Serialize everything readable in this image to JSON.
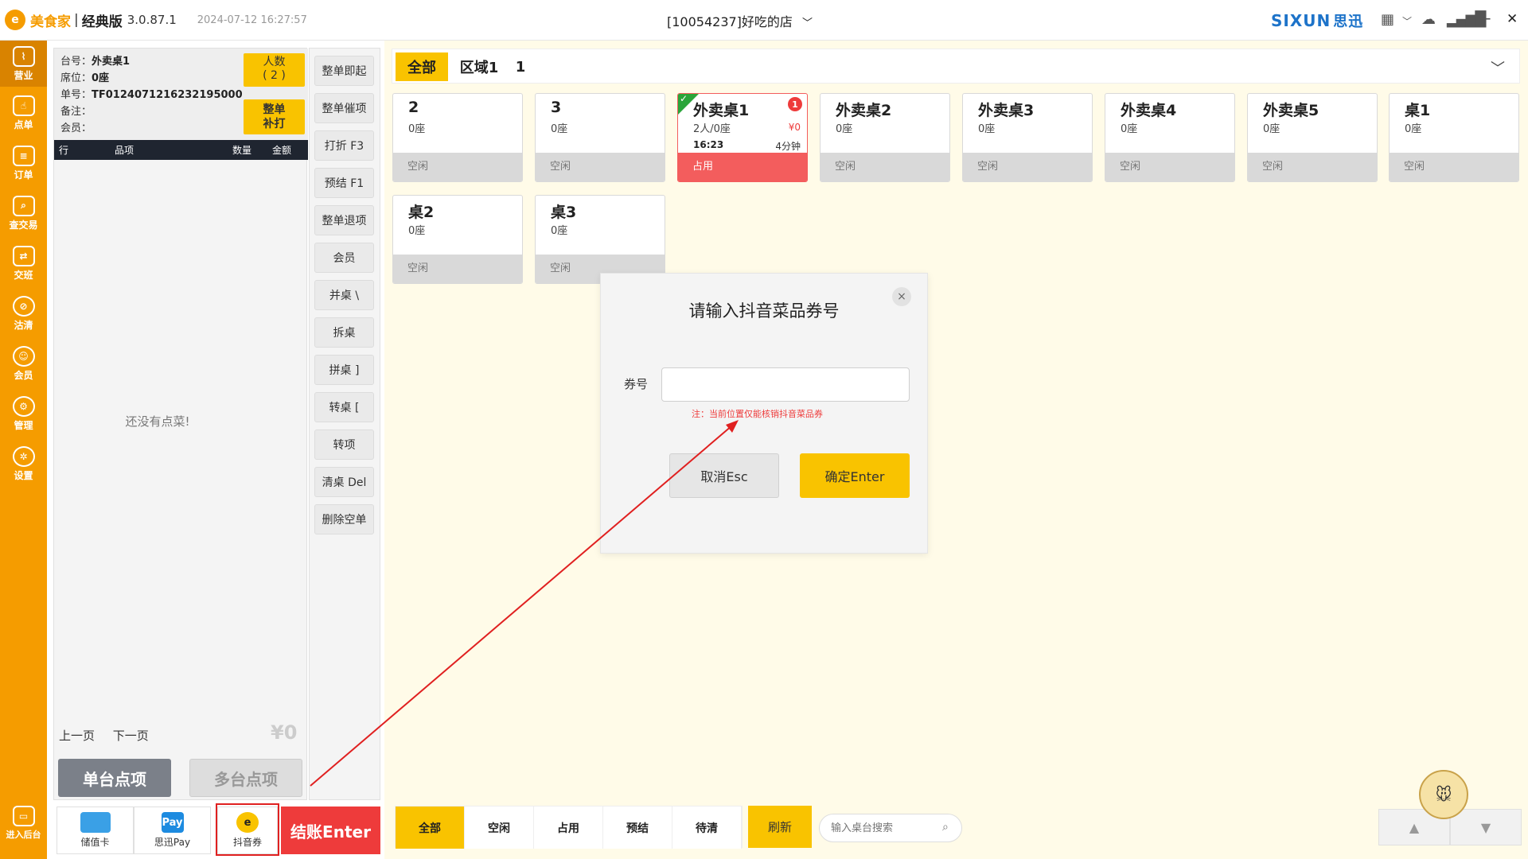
{
  "titlebar": {
    "brand": "美食家",
    "separator": "|",
    "edition": "经典版",
    "version": "3.0.87.1",
    "datetime": "2024-07-12 16:27:57",
    "store": "[10054237]好吃的店",
    "sixun_logo": "SIXUN",
    "sixun_cn": "思迅",
    "icons": [
      "grid-icon",
      "cloud-icon",
      "signal-icon",
      "minimize-icon",
      "close-icon"
    ],
    "minimize": "−",
    "close": "✕"
  },
  "sidebar": {
    "items": [
      {
        "label": "营业",
        "icon": "chart-icon",
        "active": true
      },
      {
        "label": "点单",
        "icon": "hand-icon"
      },
      {
        "label": "订单",
        "icon": "order-icon"
      },
      {
        "label": "查交易",
        "icon": "search-doc-icon"
      },
      {
        "label": "交班",
        "icon": "shift-icon"
      },
      {
        "label": "沽清",
        "icon": "soldout-icon"
      },
      {
        "label": "会员",
        "icon": "member-icon"
      },
      {
        "label": "管理",
        "icon": "manage-icon"
      },
      {
        "label": "设置",
        "icon": "settings-icon"
      }
    ],
    "backend": "进入后台"
  },
  "order": {
    "table_label": "台号：",
    "table_value": "外卖桌1",
    "seat_label": "席位：",
    "seat_value": "0座",
    "bill_label": "单号：",
    "bill_value": "TF0124071216232195000",
    "remark_label": "备注：",
    "member_label": "会员：",
    "people_btn": "人数",
    "people_count": "( 2 )",
    "reprint_btn_1": "整单",
    "reprint_btn_2": "补打",
    "columns": [
      "行",
      "品项",
      "数量",
      "金额"
    ],
    "empty": "还没有点菜!",
    "prev_page": "上一页",
    "next_page": "下一页",
    "total": "¥0",
    "single_order": "单台点项",
    "multi_order": "多台点项"
  },
  "actions": [
    "整单即起",
    "整单催项",
    "打折 F3",
    "预结 F1",
    "整单退项",
    "会员",
    "并桌 \\",
    "拆桌",
    "拼桌 ]",
    "转桌 [",
    "转项",
    "清桌 Del",
    "删除空单"
  ],
  "payments": [
    {
      "label": "储值卡",
      "icon": "card-icon",
      "color": "#3aa0e6"
    },
    {
      "label": "思迅Pay",
      "icon": "pay-icon",
      "glyph": "Pay",
      "color": "#1d8be0"
    },
    {
      "label": "抖音券",
      "icon": "douyin-coupon-icon",
      "color": "#f9c300"
    }
  ],
  "checkout": "结账Enter",
  "areas": {
    "tabs": [
      "全部",
      "区域1",
      "1"
    ]
  },
  "tables": [
    {
      "name": "2",
      "seat": "0座",
      "status": "空闲"
    },
    {
      "name": "3",
      "seat": "0座",
      "status": "空闲"
    },
    {
      "name": "外卖桌1",
      "seat": "2人/0座",
      "status": "占用",
      "amount": "¥0",
      "time": "16:23",
      "duration": "4分钟",
      "badge": "1",
      "occupied": true
    },
    {
      "name": "外卖桌2",
      "seat": "0座",
      "status": "空闲"
    },
    {
      "name": "外卖桌3",
      "seat": "0座",
      "status": "空闲"
    },
    {
      "name": "外卖桌4",
      "seat": "0座",
      "status": "空闲"
    },
    {
      "name": "外卖桌5",
      "seat": "0座",
      "status": "空闲"
    },
    {
      "name": "桌1",
      "seat": "0座",
      "status": "空闲"
    },
    {
      "name": "桌2",
      "seat": "0座",
      "status": "空闲"
    },
    {
      "name": "桌3",
      "seat": "0座",
      "status": "空闲"
    }
  ],
  "modal": {
    "title": "请输入抖音菜品券号",
    "label": "券号",
    "input_value": "",
    "note": "注：当前位置仅能核销抖音菜品券",
    "cancel": "取消Esc",
    "confirm": "确定Enter",
    "close_glyph": "×"
  },
  "filters": [
    "全部",
    "空闲",
    "占用",
    "预结",
    "待清"
  ],
  "refresh": "刷新",
  "search_placeholder": "输入桌台搜索",
  "colors": {
    "brand": "#f59c00",
    "accent": "#f9c300",
    "danger": "#ee3b3b",
    "sixun": "#1d73c9"
  }
}
